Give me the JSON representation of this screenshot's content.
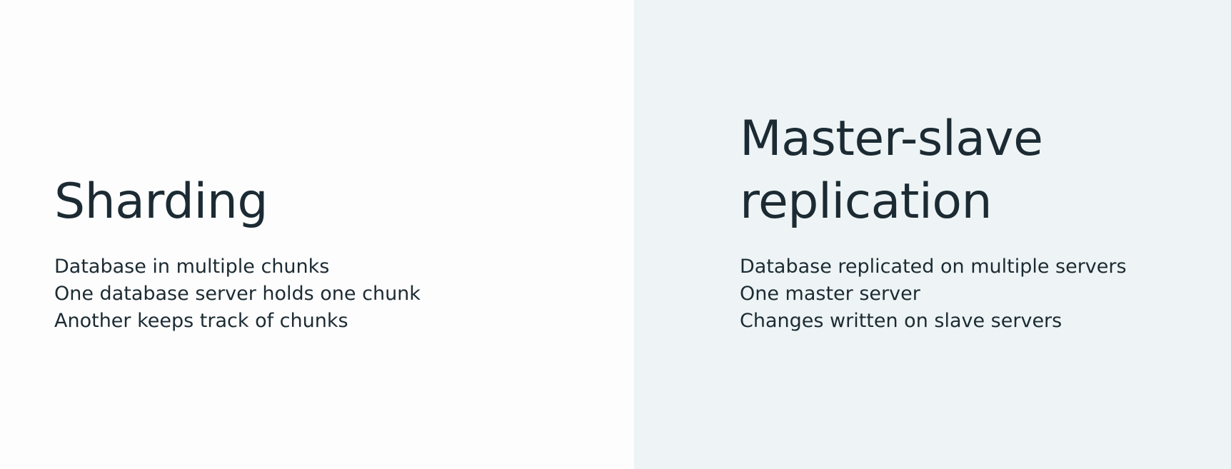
{
  "left": {
    "title": "Sharding",
    "points": [
      "Database in multiple chunks",
      "One database server holds one chunk",
      "Another keeps track of chunks"
    ]
  },
  "right": {
    "title_lines": [
      "Master-slave",
      "replication"
    ],
    "points": [
      "Database replicated on multiple servers",
      "One master server",
      "Changes written on slave servers"
    ]
  },
  "colors": {
    "left_background": "#fdfdfd",
    "right_background": "#eef4f5",
    "text": "#1c2b33"
  }
}
